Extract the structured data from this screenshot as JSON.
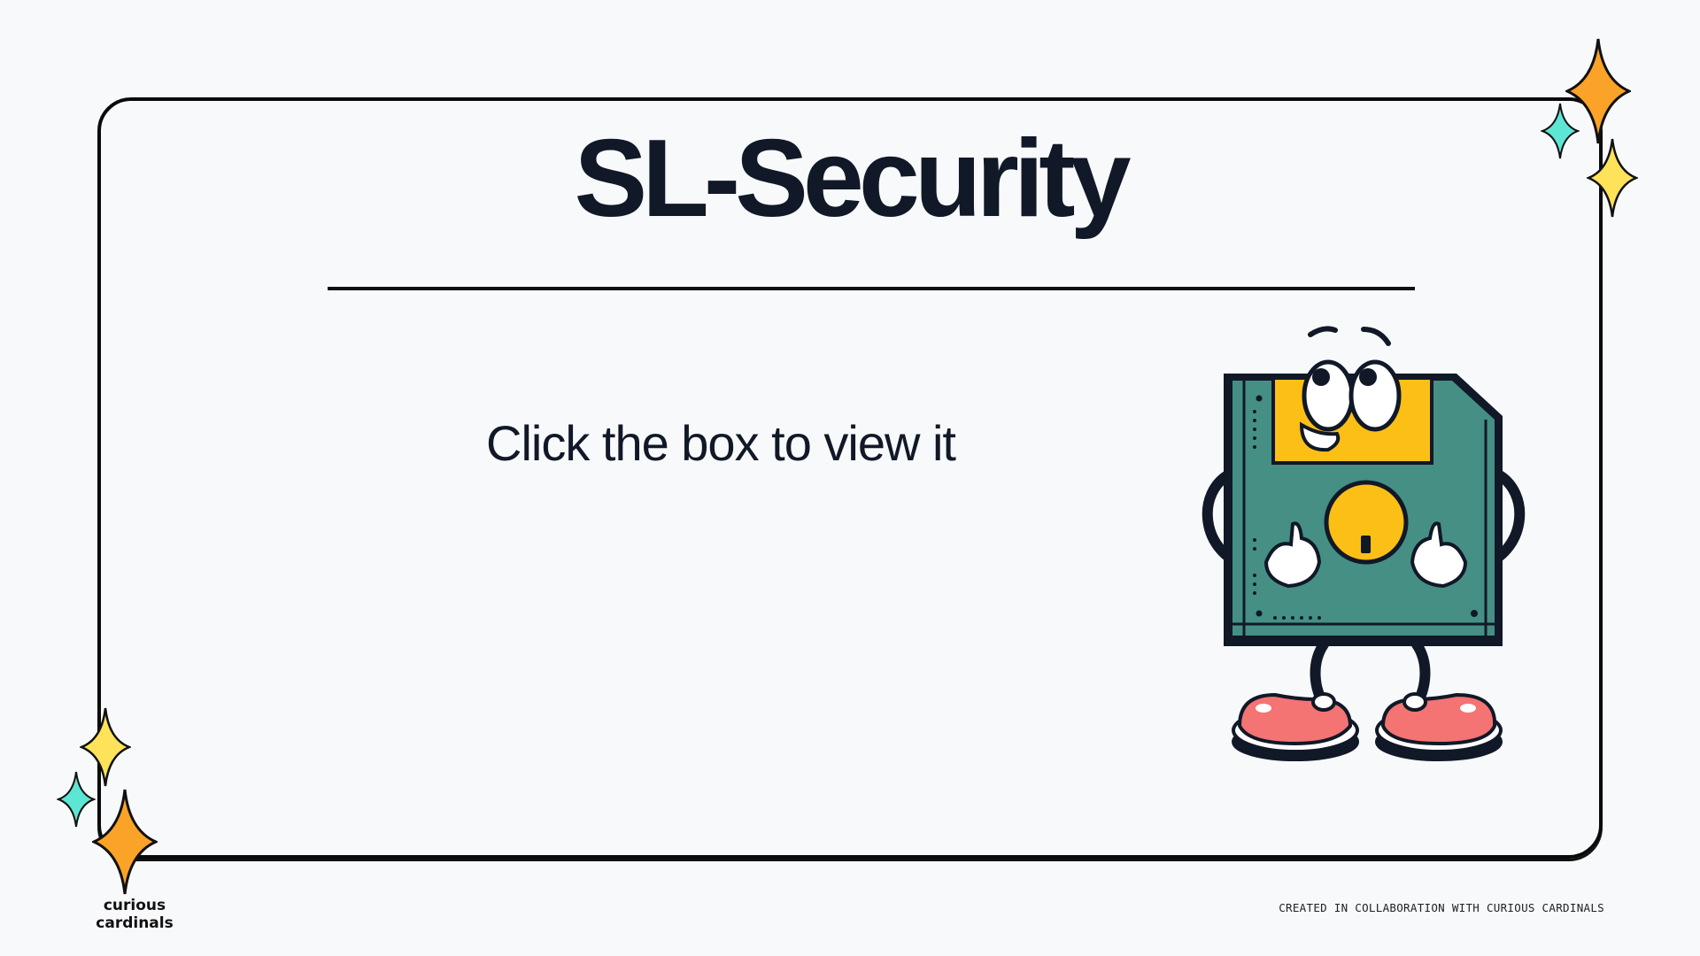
{
  "slide": {
    "title": "SL-Security",
    "instruction": "Click the box to view it"
  },
  "branding": {
    "logo_text": "curious cardinals",
    "footer": "CREATED IN COLLABORATION WITH CURIOUS CARDINALS"
  },
  "illustration": {
    "subject": "floppy-disk-mascot-icon"
  },
  "colors": {
    "background": "#f7f9fb",
    "text": "#111827",
    "disk_body": "#458f85",
    "disk_label": "#fbbf16",
    "shoes": "#f47373",
    "sparkle_orange": "#fba328",
    "sparkle_yellow": "#fde25a",
    "sparkle_teal": "#5ee6d4"
  }
}
